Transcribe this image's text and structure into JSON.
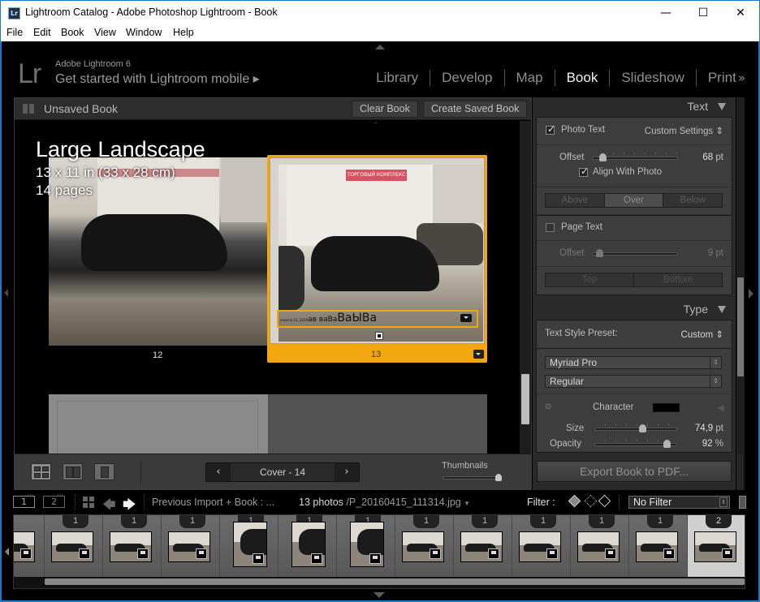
{
  "window": {
    "title": "Lightroom Catalog - Adobe Photoshop Lightroom - Book",
    "app_icon_text": "Lr",
    "controls": {
      "minimize": "—",
      "maximize": "☐",
      "close": "✕"
    }
  },
  "menu": [
    {
      "label": "File",
      "accel": "F"
    },
    {
      "label": "Edit",
      "accel": "E"
    },
    {
      "label": "Book",
      "accel": "B"
    },
    {
      "label": "View",
      "accel": "V"
    },
    {
      "label": "Window",
      "accel": "W"
    },
    {
      "label": "Help",
      "accel": "H"
    }
  ],
  "identity": {
    "logo": "Lr",
    "product": "Adobe Lightroom 6",
    "mobile_prompt": "Get started with Lightroom mobile ▸"
  },
  "modules": [
    {
      "label": "Library",
      "active": false
    },
    {
      "label": "Develop",
      "active": false
    },
    {
      "label": "Map",
      "active": false
    },
    {
      "label": "Book",
      "active": true
    },
    {
      "label": "Slideshow",
      "active": false
    },
    {
      "label": "Print",
      "active": false
    }
  ],
  "modules_more": "»",
  "center": {
    "book_title": "Unsaved Book",
    "clear_button": "Clear Book",
    "create_button": "Create Saved Book",
    "layout": {
      "name": "Large Landscape",
      "size": "13 x 11 in (33 x 28 cm)",
      "pages": "14 pages"
    },
    "pages": [
      {
        "number": "12",
        "selected": false
      },
      {
        "number": "13",
        "selected": true
      }
    ],
    "photo_sign_text": "ТОРГОВЫЙ КОМПЛЕКС",
    "photo_text": {
      "small": "апреля 15, 2016",
      "mid": "ав ваВа",
      "big": "ВаЫВа"
    },
    "toolbar": {
      "views": [
        "multi-page-view",
        "spread-view",
        "single-page-view"
      ],
      "pager_prev": "‹",
      "pager_label": "Cover - 14",
      "pager_next": "›",
      "thumbnails_label": "Thumbnails",
      "thumbnails_value": 1.0
    }
  },
  "right_panel": {
    "text_section": {
      "header": "Text",
      "photo_text": {
        "label": "Photo Text",
        "checked": true,
        "preset": "Custom Settings ⇕"
      },
      "offset_label": "Offset",
      "offset_value": "68",
      "offset_unit": "pt",
      "offset_fraction": 0.12,
      "align_label": "Align With Photo",
      "align_checked": true,
      "position_options": [
        "Above",
        "Over",
        "Below"
      ],
      "position_selected": "Over",
      "page_text": {
        "label": "Page Text",
        "checked": false
      },
      "page_offset_label": "Offset",
      "page_offset_value": "9",
      "page_offset_unit": "pt",
      "page_offset_fraction": 0.08,
      "page_position_options": [
        "Top",
        "Bottom"
      ]
    },
    "type_section": {
      "header": "Type",
      "preset_label": "Text Style Preset:",
      "preset_value": "Custom ⇕",
      "font": "Myriad Pro",
      "style": "Regular",
      "character_label": "Character",
      "character_color": "#000000",
      "size_label": "Size",
      "size_value": "74,9",
      "size_unit": "pt",
      "size_fraction": 0.58,
      "opacity_label": "Opacity",
      "opacity_value": "92",
      "opacity_unit": "%",
      "opacity_fraction": 0.88
    },
    "export_button": "Export Book to PDF..."
  },
  "filmstrip_bar": {
    "monitor1": "1",
    "monitor2": "2",
    "source": "Previous Import  +  Book : ...",
    "count": "13 photos",
    "path": "/P_20160415_111314.jpg",
    "path_dropdown": "▾",
    "filter_label": "Filter :",
    "filter_value": "No Filter",
    "arrow_back": "🡄",
    "arrow_forward": "🡆"
  },
  "filmstrip": {
    "items": [
      {
        "count": "",
        "tall": false,
        "selected": false,
        "partial": true
      },
      {
        "count": "1",
        "tall": false,
        "selected": false
      },
      {
        "count": "1",
        "tall": false,
        "selected": false
      },
      {
        "count": "1",
        "tall": false,
        "selected": false
      },
      {
        "count": "1",
        "tall": true,
        "selected": false
      },
      {
        "count": "1",
        "tall": true,
        "selected": false
      },
      {
        "count": "1",
        "tall": true,
        "selected": false
      },
      {
        "count": "1",
        "tall": false,
        "selected": false
      },
      {
        "count": "1",
        "tall": false,
        "selected": false
      },
      {
        "count": "1",
        "tall": false,
        "selected": false
      },
      {
        "count": "1",
        "tall": false,
        "selected": false
      },
      {
        "count": "1",
        "tall": false,
        "selected": false
      },
      {
        "count": "2",
        "tall": false,
        "selected": true
      }
    ]
  },
  "colors": {
    "accent_selection": "#f3a70f",
    "window_border": "#1979ca",
    "panel_bg": "#3d3d3d"
  }
}
